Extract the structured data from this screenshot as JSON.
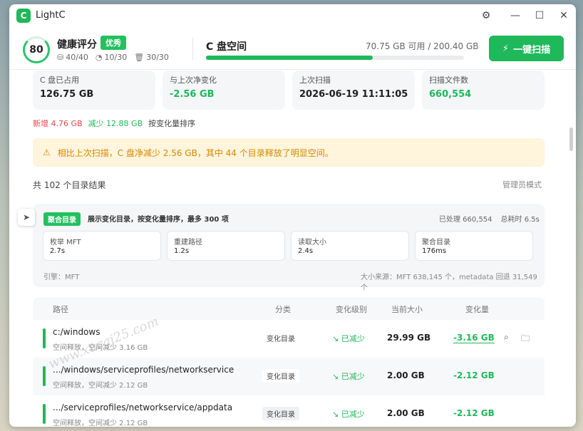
{
  "app": {
    "title": "LightC",
    "logo": "C"
  },
  "window_controls": {
    "settings_icon": "⚙",
    "minimize": "—",
    "maximize": "☐",
    "close": "✕"
  },
  "header": {
    "score": "80",
    "health_title": "健康评分",
    "health_badge": "优秀",
    "stats": [
      {
        "icon": "disk-icon",
        "glyph": "⛁",
        "value": "40/40"
      },
      {
        "icon": "clock-icon",
        "glyph": "◔",
        "value": "10/30"
      },
      {
        "icon": "trash-icon",
        "glyph": "🗑",
        "value": "30/30"
      }
    ],
    "disk_title": "C 盘空间",
    "disk_usage": "70.75 GB 可用 / 200.40 GB",
    "disk_used_fraction": 0.647,
    "scan_button": "一键扫描",
    "scan_icon": "⚡"
  },
  "cards": [
    {
      "label": "C 盘已占用",
      "value": "126.75 GB",
      "green": false
    },
    {
      "label": "与上次净变化",
      "value": "-2.56 GB",
      "green": true
    },
    {
      "label": "上次扫描",
      "value": "2026-06-19 11:11:05",
      "green": false
    },
    {
      "label": "扫描文件数",
      "value": "660,554",
      "green": true
    }
  ],
  "delta": {
    "added_label": "新增",
    "added_value": "4.76 GB",
    "reduced_label": "减少",
    "reduced_value": "12.88 GB",
    "sort_label": "按变化量排序"
  },
  "notice": {
    "icon": "⚠",
    "text": "相比上次扫描，C 盘净减少 2.56 GB，其中 44 个目录释放了明显空间。"
  },
  "results": {
    "title": "共 102 个目录结果",
    "admin": "管理员模式"
  },
  "side_nav_icon": "➤",
  "perf": {
    "badge": "聚合目录",
    "desc": "展示变化目录，按变化量排序，最多 300 项",
    "processed": "已处理 660,554",
    "total_time": "总耗时 6.5s",
    "steps": [
      {
        "label": "枚举 MFT",
        "value": "2.7s"
      },
      {
        "label": "重建路径",
        "value": "1.2s"
      },
      {
        "label": "读取大小",
        "value": "2.4s"
      },
      {
        "label": "聚合目录",
        "value": "176ms"
      }
    ],
    "engine": "引擎：MFT",
    "size_source": "大小来源：MFT 638,145 个，metadata 回退 31,549 个"
  },
  "table": {
    "headers": {
      "path": "路径",
      "category": "分类",
      "level": "变化级别",
      "size": "当前大小",
      "delta": "变化量"
    },
    "rows": [
      {
        "path": "c:/windows",
        "sub": "空间释放，空间减少 3.16 GB",
        "category": "变化目录",
        "level": "↘ 已减少",
        "size": "29.99 GB",
        "delta": "-3.16 GB"
      },
      {
        "path": ".../windows/serviceprofiles/networkservice",
        "sub": "空间释放，空间减少 2.12 GB",
        "category": "变化目录",
        "level": "↘ 已减少",
        "size": "2.00 GB",
        "delta": "-2.12 GB"
      },
      {
        "path": ".../serviceprofiles/networkservice/appdata",
        "sub": "空间释放，空间减少 2.12 GB",
        "category": "变化目录",
        "level": "↘ 已减少",
        "size": "2.00 GB",
        "delta": "-2.12 GB"
      }
    ],
    "row_actions": {
      "search": "⌕",
      "folder": "🗀"
    }
  },
  "watermark": "www.xucai25.com"
}
